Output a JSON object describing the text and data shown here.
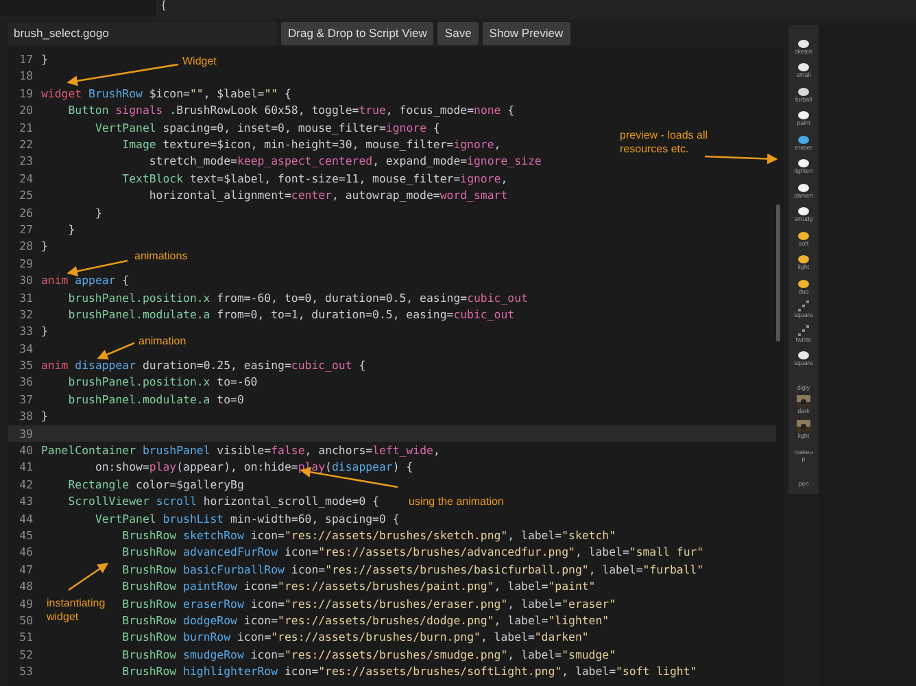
{
  "top_bar": {
    "text": "{"
  },
  "toolbar": {
    "file_name": "brush_select.gogo",
    "buttons": [
      "Drag & Drop to Script View",
      "Save",
      "Show Preview"
    ]
  },
  "editor": {
    "lines": [
      {
        "number": "17",
        "highlighted": false,
        "tokens": [
          {
            "kind": "plain",
            "text": "}"
          }
        ]
      },
      {
        "number": "18",
        "highlighted": false
      },
      {
        "number": "19",
        "highlighted": false,
        "tokens": [
          {
            "kind": "kw",
            "text": "widget "
          },
          {
            "kind": "ident",
            "text": "BrushRow"
          },
          {
            "kind": "plain",
            "text": " $icon="
          },
          {
            "kind": "str",
            "text": "\"\""
          },
          {
            "kind": "plain",
            "text": ", $label="
          },
          {
            "kind": "str",
            "text": "\"\""
          },
          {
            "kind": "plain",
            "text": " {"
          }
        ]
      },
      {
        "number": "20",
        "highlighted": false,
        "tokens": [
          {
            "kind": "type",
            "text": "    Button "
          },
          {
            "kind": "val",
            "text": "signals"
          },
          {
            "kind": "plain",
            "text": " .BrushRowLook 60x58, toggle="
          },
          {
            "kind": "val",
            "text": "true"
          },
          {
            "kind": "plain",
            "text": ", focus_mode="
          },
          {
            "kind": "val",
            "text": "none"
          },
          {
            "kind": "plain",
            "text": " {"
          }
        ]
      },
      {
        "number": "21",
        "highlighted": false,
        "tokens": [
          {
            "kind": "type",
            "text": "        VertPanel"
          },
          {
            "kind": "plain",
            "text": " spacing=0, inset=0, mouse_filter="
          },
          {
            "kind": "val",
            "text": "ignore"
          },
          {
            "kind": "plain",
            "text": " {"
          }
        ]
      },
      {
        "number": "22",
        "highlighted": false,
        "tokens": [
          {
            "kind": "type",
            "text": "            Image"
          },
          {
            "kind": "plain",
            "text": " texture=$icon, min-height=30, mouse_filter="
          },
          {
            "kind": "val",
            "text": "ignore"
          },
          {
            "kind": "plain",
            "text": ","
          }
        ]
      },
      {
        "number": "23",
        "highlighted": false,
        "tokens": [
          {
            "kind": "plain",
            "text": "                stretch_mode="
          },
          {
            "kind": "val",
            "text": "keep_aspect_centered"
          },
          {
            "kind": "plain",
            "text": ", expand_mode="
          },
          {
            "kind": "val",
            "text": "ignore_size"
          }
        ]
      },
      {
        "number": "24",
        "highlighted": false,
        "tokens": [
          {
            "kind": "type",
            "text": "            TextBlock"
          },
          {
            "kind": "plain",
            "text": " text=$label, font-size=11, mouse_filter="
          },
          {
            "kind": "val",
            "text": "ignore"
          },
          {
            "kind": "plain",
            "text": ","
          }
        ]
      },
      {
        "number": "25",
        "highlighted": false,
        "tokens": [
          {
            "kind": "plain",
            "text": "                horizontal_alignment="
          },
          {
            "kind": "val",
            "text": "center"
          },
          {
            "kind": "plain",
            "text": ", autowrap_mode="
          },
          {
            "kind": "val",
            "text": "word_smart"
          }
        ]
      },
      {
        "number": "26",
        "highlighted": false,
        "tokens": [
          {
            "kind": "plain",
            "text": "        }"
          }
        ]
      },
      {
        "number": "27",
        "highlighted": false,
        "tokens": [
          {
            "kind": "plain",
            "text": "    }"
          }
        ]
      },
      {
        "number": "28",
        "highlighted": false,
        "tokens": [
          {
            "kind": "plain",
            "text": "}"
          }
        ]
      },
      {
        "number": "29",
        "highlighted": false
      },
      {
        "number": "30",
        "highlighted": false,
        "tokens": [
          {
            "kind": "kw",
            "text": "anim "
          },
          {
            "kind": "ident",
            "text": "appear"
          },
          {
            "kind": "plain",
            "text": " {"
          }
        ]
      },
      {
        "number": "31",
        "highlighted": false,
        "tokens": [
          {
            "kind": "type",
            "text": "    brushPanel.position.x"
          },
          {
            "kind": "plain",
            "text": " from=-60, to=0, duration=0.5, easing="
          },
          {
            "kind": "val",
            "text": "cubic_out"
          }
        ]
      },
      {
        "number": "32",
        "highlighted": false,
        "tokens": [
          {
            "kind": "type",
            "text": "    brushPanel.modulate.a"
          },
          {
            "kind": "plain",
            "text": " from=0, to=1, duration=0.5, easing="
          },
          {
            "kind": "val",
            "text": "cubic_out"
          }
        ]
      },
      {
        "number": "33",
        "highlighted": false,
        "tokens": [
          {
            "kind": "plain",
            "text": "}"
          }
        ]
      },
      {
        "number": "34",
        "highlighted": false
      },
      {
        "number": "35",
        "highlighted": false,
        "tokens": [
          {
            "kind": "kw",
            "text": "anim "
          },
          {
            "kind": "ident",
            "text": "disappear"
          },
          {
            "kind": "plain",
            "text": " duration=0.25, easing="
          },
          {
            "kind": "val",
            "text": "cubic_out"
          },
          {
            "kind": "plain",
            "text": " {"
          }
        ]
      },
      {
        "number": "36",
        "highlighted": false,
        "tokens": [
          {
            "kind": "type",
            "text": "    brushPanel.position.x"
          },
          {
            "kind": "plain",
            "text": " to=-60"
          }
        ]
      },
      {
        "number": "37",
        "highlighted": false,
        "tokens": [
          {
            "kind": "type",
            "text": "    brushPanel.modulate.a"
          },
          {
            "kind": "plain",
            "text": " to=0"
          }
        ]
      },
      {
        "number": "38",
        "highlighted": false,
        "tokens": [
          {
            "kind": "plain",
            "text": "}"
          }
        ]
      },
      {
        "number": "39",
        "highlighted": true
      },
      {
        "number": "40",
        "highlighted": false,
        "tokens": [
          {
            "kind": "type",
            "text": "PanelContainer "
          },
          {
            "kind": "ident",
            "text": "brushPanel"
          },
          {
            "kind": "plain",
            "text": " visible="
          },
          {
            "kind": "val",
            "text": "false"
          },
          {
            "kind": "plain",
            "text": ", anchors="
          },
          {
            "kind": "val",
            "text": "left_wide"
          },
          {
            "kind": "plain",
            "text": ","
          }
        ]
      },
      {
        "number": "41",
        "highlighted": false,
        "tokens": [
          {
            "kind": "plain",
            "text": "        on:show="
          },
          {
            "kind": "val",
            "text": "play"
          },
          {
            "kind": "plain",
            "text": "(appear), on:hide="
          },
          {
            "kind": "val",
            "text": "play"
          },
          {
            "kind": "plain",
            "text": "("
          },
          {
            "kind": "ident",
            "text": "disappear"
          },
          {
            "kind": "plain",
            "text": ") {"
          }
        ]
      },
      {
        "number": "42",
        "highlighted": false,
        "tokens": [
          {
            "kind": "type",
            "text": "    Rectangle"
          },
          {
            "kind": "plain",
            "text": " color=$galleryBg"
          }
        ]
      },
      {
        "number": "43",
        "highlighted": false,
        "tokens": [
          {
            "kind": "type",
            "text": "    ScrollViewer "
          },
          {
            "kind": "ident",
            "text": "scroll"
          },
          {
            "kind": "plain",
            "text": " horizontal_scroll_mode=0 {"
          }
        ]
      },
      {
        "number": "44",
        "highlighted": false,
        "tokens": [
          {
            "kind": "type",
            "text": "        VertPanel "
          },
          {
            "kind": "ident",
            "text": "brushList"
          },
          {
            "kind": "plain",
            "text": " min-width=60, spacing=0 {"
          }
        ]
      },
      {
        "number": "45",
        "highlighted": false,
        "tokens": [
          {
            "kind": "type",
            "text": "            BrushRow "
          },
          {
            "kind": "ident",
            "text": "sketchRow"
          },
          {
            "kind": "plain",
            "text": " icon="
          },
          {
            "kind": "str",
            "text": "\"res://assets/brushes/sketch.png\""
          },
          {
            "kind": "plain",
            "text": ", label="
          },
          {
            "kind": "str",
            "text": "\"sketch\""
          }
        ]
      },
      {
        "number": "46",
        "highlighted": false,
        "tokens": [
          {
            "kind": "type",
            "text": "            BrushRow "
          },
          {
            "kind": "ident",
            "text": "advancedFurRow"
          },
          {
            "kind": "plain",
            "text": " icon="
          },
          {
            "kind": "str",
            "text": "\"res://assets/brushes/advancedfur.png\""
          },
          {
            "kind": "plain",
            "text": ", label="
          },
          {
            "kind": "str",
            "text": "\"small fur\""
          }
        ]
      },
      {
        "number": "47",
        "highlighted": false,
        "tokens": [
          {
            "kind": "type",
            "text": "            BrushRow "
          },
          {
            "kind": "ident",
            "text": "basicFurballRow"
          },
          {
            "kind": "plain",
            "text": " icon="
          },
          {
            "kind": "str",
            "text": "\"res://assets/brushes/basicfurball.png\""
          },
          {
            "kind": "plain",
            "text": ", label="
          },
          {
            "kind": "str",
            "text": "\"furball\""
          }
        ]
      },
      {
        "number": "48",
        "highlighted": false,
        "tokens": [
          {
            "kind": "type",
            "text": "            BrushRow "
          },
          {
            "kind": "ident",
            "text": "paintRow"
          },
          {
            "kind": "plain",
            "text": " icon="
          },
          {
            "kind": "str",
            "text": "\"res://assets/brushes/paint.png\""
          },
          {
            "kind": "plain",
            "text": ", label="
          },
          {
            "kind": "str",
            "text": "\"paint\""
          }
        ]
      },
      {
        "number": "49",
        "highlighted": false,
        "tokens": [
          {
            "kind": "type",
            "text": "            BrushRow "
          },
          {
            "kind": "ident",
            "text": "eraserRow"
          },
          {
            "kind": "plain",
            "text": " icon="
          },
          {
            "kind": "str",
            "text": "\"res://assets/brushes/eraser.png\""
          },
          {
            "kind": "plain",
            "text": ", label="
          },
          {
            "kind": "str",
            "text": "\"eraser\""
          }
        ]
      },
      {
        "number": "50",
        "highlighted": false,
        "tokens": [
          {
            "kind": "type",
            "text": "            BrushRow "
          },
          {
            "kind": "ident",
            "text": "dodgeRow"
          },
          {
            "kind": "plain",
            "text": " icon="
          },
          {
            "kind": "str",
            "text": "\"res://assets/brushes/dodge.png\""
          },
          {
            "kind": "plain",
            "text": ", label="
          },
          {
            "kind": "str",
            "text": "\"lighten\""
          }
        ]
      },
      {
        "number": "51",
        "highlighted": false,
        "tokens": [
          {
            "kind": "type",
            "text": "            BrushRow "
          },
          {
            "kind": "ident",
            "text": "burnRow"
          },
          {
            "kind": "plain",
            "text": " icon="
          },
          {
            "kind": "str",
            "text": "\"res://assets/brushes/burn.png\""
          },
          {
            "kind": "plain",
            "text": ", label="
          },
          {
            "kind": "str",
            "text": "\"darken\""
          }
        ]
      },
      {
        "number": "52",
        "highlighted": false,
        "tokens": [
          {
            "kind": "type",
            "text": "            BrushRow "
          },
          {
            "kind": "ident",
            "text": "smudgeRow"
          },
          {
            "kind": "plain",
            "text": " icon="
          },
          {
            "kind": "str",
            "text": "\"res://assets/brushes/smudge.png\""
          },
          {
            "kind": "plain",
            "text": ", label="
          },
          {
            "kind": "str",
            "text": "\"smudge\""
          }
        ]
      },
      {
        "number": "53",
        "highlighted": false,
        "tokens": [
          {
            "kind": "type",
            "text": "            BrushRow "
          },
          {
            "kind": "ident",
            "text": "highlighterRow"
          },
          {
            "kind": "plain",
            "text": " icon="
          },
          {
            "kind": "str",
            "text": "\"res://assets/brushes/softLight.png\""
          },
          {
            "kind": "plain",
            "text": ", label="
          },
          {
            "kind": "str",
            "text": "\"soft light\""
          }
        ]
      }
    ]
  },
  "preview": {
    "items": [
      {
        "label": "sketch",
        "kind": "brush",
        "color": "#e8e8e8"
      },
      {
        "label": "small",
        "kind": "brush",
        "color": "#e8e8e8"
      },
      {
        "label": "furball",
        "kind": "brush",
        "color": "#d8d8d8"
      },
      {
        "label": "paint",
        "kind": "brush",
        "color": "#f2f2f2"
      },
      {
        "label": "eraser",
        "kind": "brush",
        "color": "#4aa8e8"
      },
      {
        "label": "lighten",
        "kind": "brush",
        "color": "#f2f2f2"
      },
      {
        "label": "darken",
        "kind": "brush",
        "color": "#f2f2f2"
      },
      {
        "label": "smudg",
        "kind": "brush",
        "color": "#f2f2f2"
      },
      {
        "label": "soft",
        "kind": "brush",
        "color": "#f0b030"
      },
      {
        "label": "light",
        "kind": "brush",
        "color": "#f0b030"
      },
      {
        "label": "duo",
        "kind": "brush",
        "color": "#f0b030"
      },
      {
        "label": "square",
        "kind": "stroke",
        "color": "#8a8a8a"
      },
      {
        "label": "twiste",
        "kind": "stroke",
        "color": "#8a8a8a"
      },
      {
        "label": "square",
        "kind": "brush",
        "color": "#e8e8e8"
      },
      {
        "label": "digly",
        "kind": "blank"
      },
      {
        "label": "dark"
      },
      {
        "label": "light"
      },
      {
        "label": "makeup",
        "kind": "blank"
      },
      {
        "label": "pen",
        "kind": "blank"
      }
    ]
  },
  "annotations": [
    "Widget",
    "animations",
    "animation",
    "using the animation",
    "instantiating widget",
    "preview - loads all resources etc."
  ]
}
